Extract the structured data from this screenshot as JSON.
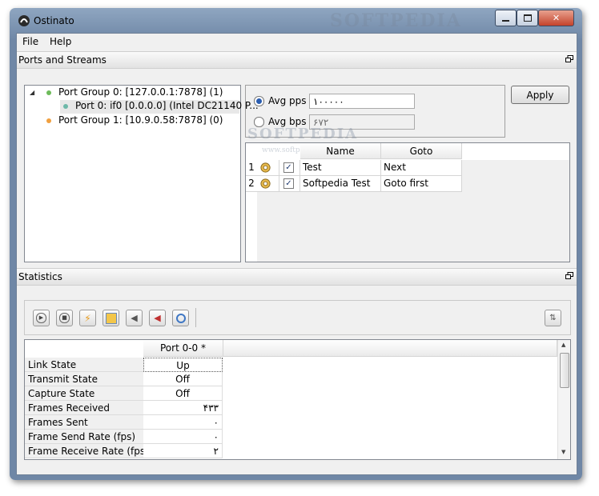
{
  "window": {
    "title": "Ostinato"
  },
  "menu": {
    "file": "File",
    "help": "Help"
  },
  "docks": {
    "ports_title": "Ports and Streams",
    "stats_title": "Statistics"
  },
  "tree": {
    "items": [
      {
        "label": "Port Group 0:  [127.0.0.1:7878] (1)",
        "dot_color": "#6dbb5a"
      },
      {
        "label": "Port 0: if0  [0.0.0.0] (Intel DC21140 P...",
        "dot_color": "#6db8a8"
      },
      {
        "label": "Port Group 1:  [10.9.0.58:7878] (0)",
        "dot_color": "#f0a040"
      }
    ]
  },
  "rates": {
    "avg_pps_label": "Avg pps",
    "avg_pps_value": "۱۰۰۰۰۰",
    "avg_bps_label": "Avg bps",
    "avg_bps_value": "۶۷۲",
    "apply_label": "Apply"
  },
  "streams": {
    "headers": {
      "name": "Name",
      "goto": "Goto"
    },
    "rows": [
      {
        "num": "1",
        "checked": "✓",
        "name": "Test",
        "goto": "Next"
      },
      {
        "num": "2",
        "checked": "✓",
        "name": "Softpedia Test",
        "goto": "Goto first"
      }
    ]
  },
  "stats": {
    "column_header": "Port 0-0 *",
    "rows": [
      {
        "label": "Link State",
        "value": "Up"
      },
      {
        "label": "Transmit State",
        "value": "Off"
      },
      {
        "label": "Capture State",
        "value": "Off"
      },
      {
        "label": "Frames Received",
        "value": "۴۳۳"
      },
      {
        "label": "Frames Sent",
        "value": "۰"
      },
      {
        "label": "Frame Send Rate (fps)",
        "value": "۰"
      },
      {
        "label": "Frame Receive Rate (fps)",
        "value": "۲"
      }
    ]
  },
  "watermark": {
    "top": "SOFTPEDIA",
    "mid": "SOFTPEDIA",
    "url": "www.softpedia.com"
  }
}
